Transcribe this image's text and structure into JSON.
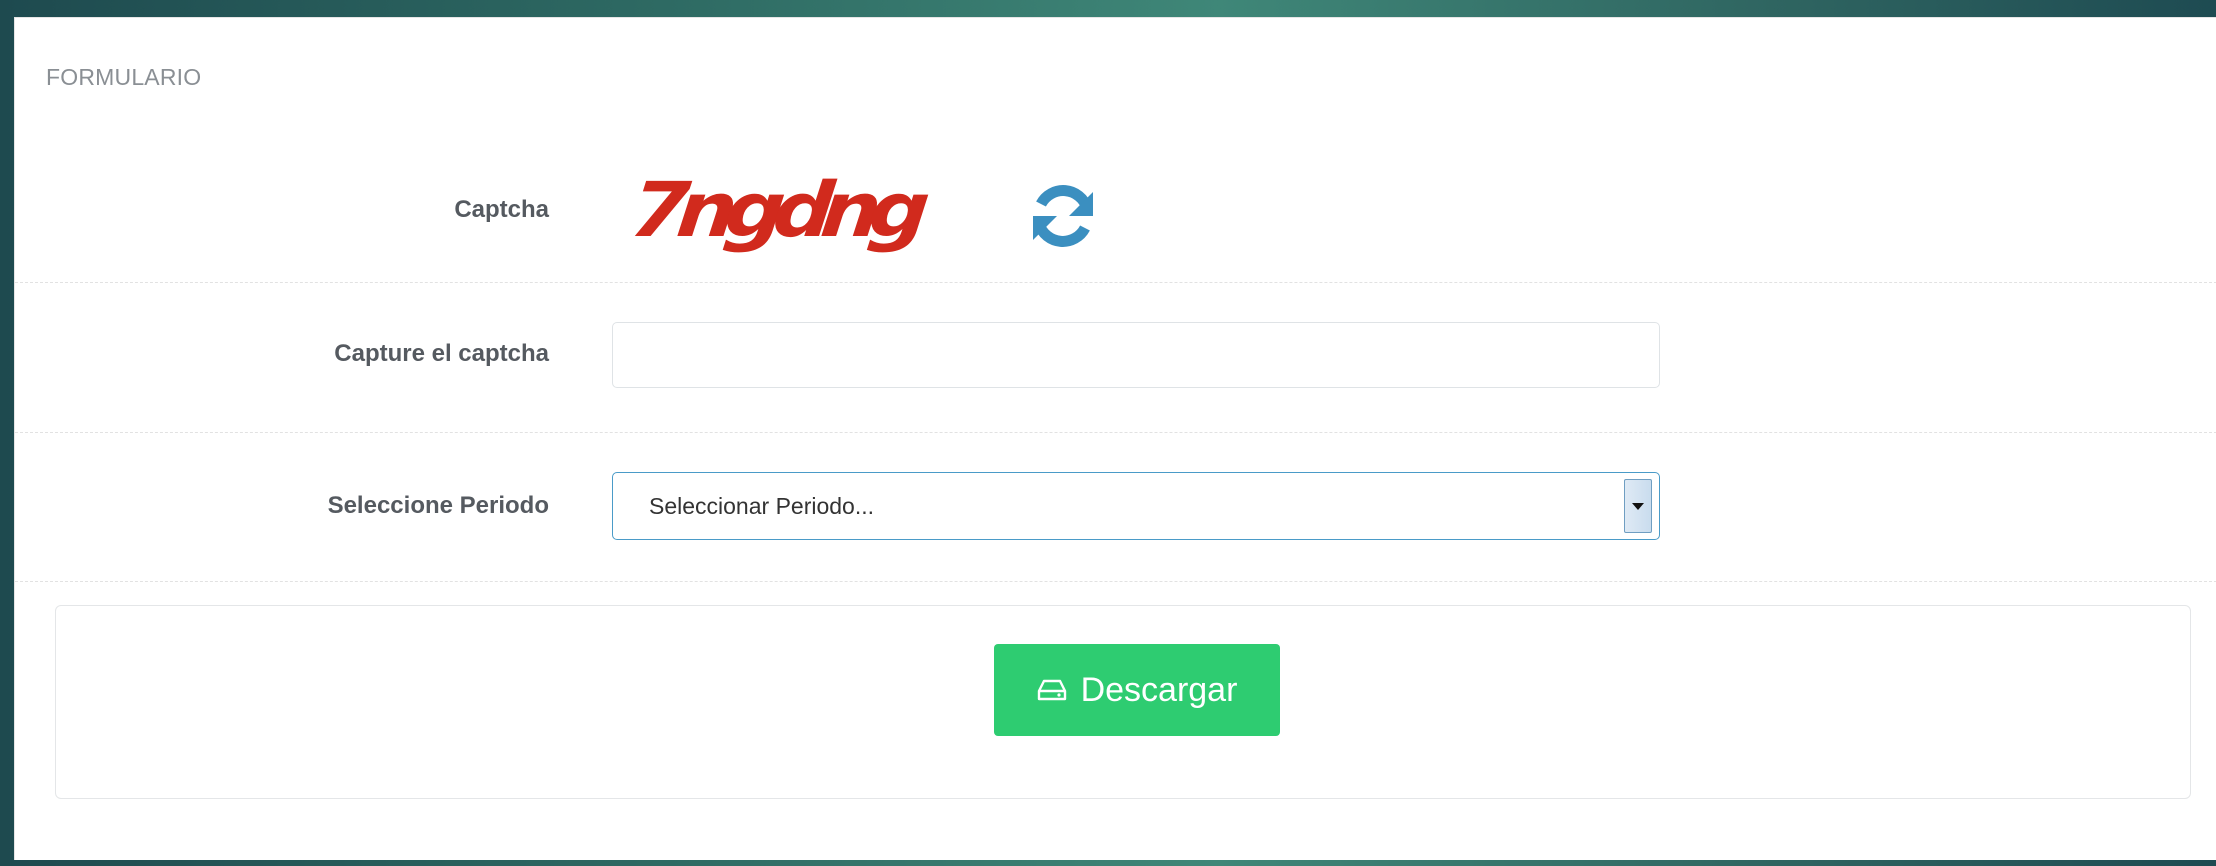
{
  "panel": {
    "title": "FORMULARIO"
  },
  "captcha": {
    "label": "Captcha",
    "image_text": "7ngdng",
    "refresh_icon": "refresh-icon"
  },
  "captcha_input": {
    "label": "Capture el captcha",
    "value": "",
    "placeholder": ""
  },
  "period": {
    "label": "Seleccione Periodo",
    "selected": "Seleccionar Periodo..."
  },
  "actions": {
    "download_label": "Descargar",
    "download_icon": "hdd-icon"
  },
  "colors": {
    "button": "#2ecc71",
    "captcha_text": "#d12a1d",
    "refresh": "#3b8fc0",
    "select_border": "#4a9bc8"
  }
}
